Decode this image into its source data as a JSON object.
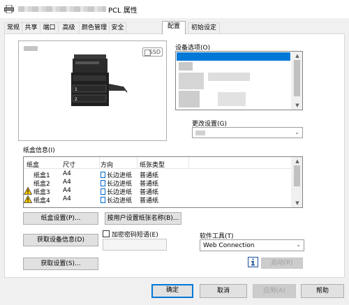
{
  "title": {
    "blurred_prefix": "",
    "text": "PCL 属性"
  },
  "tabs": [
    "常规",
    "共享",
    "端口",
    "高级",
    "颜色管理",
    "安全",
    "配置",
    "初始设定"
  ],
  "active_tab": "配置",
  "preview": {
    "ssd_label": "SSD"
  },
  "device_options": {
    "label": "设备选项(O)"
  },
  "change_settings": {
    "label": "更改设置(G)",
    "value": ""
  },
  "tray_info": {
    "label": "纸盒信息(I)",
    "headers": [
      "纸盒",
      "尺寸",
      "方向",
      "纸张类型"
    ],
    "rows": [
      {
        "tray": "纸盒1",
        "size": "A4",
        "direction": "长边进纸",
        "type": "普通纸",
        "warning": false
      },
      {
        "tray": "纸盒2",
        "size": "A4",
        "direction": "长边进纸",
        "type": "普通纸",
        "warning": false
      },
      {
        "tray": "纸盒3",
        "size": "A4",
        "direction": "长边进纸",
        "type": "普通纸",
        "warning": true
      },
      {
        "tray": "纸盒4",
        "size": "A4",
        "direction": "长边进纸",
        "type": "普通纸",
        "warning": true
      }
    ]
  },
  "buttons": {
    "tray_settings": "纸盒设置(P)...",
    "user_paper_name": "按用户设置纸张名称(B)...",
    "get_device_info": "获取设备信息(D)",
    "get_settings": "获取设置(S)...",
    "launch": "启动(R)",
    "ok": "确定",
    "cancel": "取消",
    "apply": "应用(A)",
    "help": "帮助"
  },
  "encrypt_passphrase": {
    "label": "加密密码短语(E)",
    "checked": false,
    "value": ""
  },
  "software_tool": {
    "label": "软件工具(T)",
    "value": "Web Connection"
  },
  "colors": {
    "accent": "#0078d7",
    "selection": "#cce8ff",
    "warning": "#ffcc00"
  },
  "icons": [
    "printer-icon",
    "ssd-icon",
    "warning-icon",
    "info-icon",
    "chevron-down-icon"
  ]
}
